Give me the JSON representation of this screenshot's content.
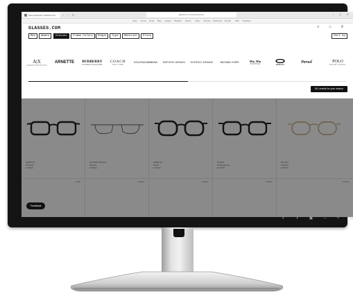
{
  "browser": {
    "tab_title": "Shop Eyewear | Glasses.com",
    "nav_buttons": "‹ › ⟳",
    "url": "glasses.com/shop/eyewear",
    "window_buttons": "– ▢ ✕",
    "bookmarks": [
      "Apps",
      "Home",
      "News",
      "Blog",
      "Images",
      "Weather",
      "Sports",
      "Video",
      "Finance",
      "Facebook",
      "Tutorial",
      "Mail",
      "Translate"
    ]
  },
  "site": {
    "logo": "GLASSES.COM",
    "header_icons": "⌕ ⌂ ≡",
    "filters": [
      {
        "label": "Men",
        "active": false
      },
      {
        "label": "Women",
        "active": false
      },
      {
        "label": "Glasses",
        "active": true
      },
      {
        "label": "Frame Colors",
        "active": false
      },
      {
        "label": "Shape",
        "active": false
      },
      {
        "label": "Type",
        "active": false
      },
      {
        "label": "Material",
        "active": false
      },
      {
        "label": "Price",
        "active": false
      }
    ],
    "sort_label": "Sort by"
  },
  "brands": [
    {
      "name": "A|X",
      "sub": "ARMANI EXCHANGE"
    },
    {
      "name": "ARNETTE",
      "sub": ""
    },
    {
      "name": "BURBERRY",
      "sub": "LONDON ENGLAND"
    },
    {
      "name": "COACH",
      "sub": "NEW YORK"
    },
    {
      "name": "DOLCE&GABBANA",
      "sub": ""
    },
    {
      "name": "EMPORIO ARMANI",
      "sub": ""
    },
    {
      "name": "GIORGIO ARMANI",
      "sub": ""
    },
    {
      "name": "MICHAEL KORS",
      "sub": ""
    },
    {
      "name": "Miu Miu",
      "sub": "EYEWEAR"
    },
    {
      "name": "OAKLEY",
      "sub": ""
    },
    {
      "name": "Persol",
      "sub": ""
    },
    {
      "name": "POLO",
      "sub": "RALPH LAUREN"
    }
  ],
  "results_label": "611 results for your search",
  "products": [
    {
      "brand": "ARNETTE",
      "model": "Standard",
      "price": "$ 105.00"
    },
    {
      "brand": "RAY-BAN OPTICAL",
      "model": "Rimless",
      "price": "$ 150.00"
    },
    {
      "brand": "ARNETTE",
      "model": "Round",
      "price": "$ 180.00"
    },
    {
      "brand": "COACH",
      "model": "Rectangle Line",
      "price": "$ 176.00"
    },
    {
      "brand": "MIU MIU",
      "model": "Oval Mix",
      "price": "$ 365.00"
    }
  ],
  "second_row_tags": [
    "1 color",
    "2 colors",
    "2 colors",
    "3 colors",
    "2 colors"
  ],
  "feedback_label": "Feedback",
  "monitor_controls": "◐ ◑ ▣ – + ⏻",
  "colors": {
    "overlay": "#8a8a8a",
    "accent": "#111111",
    "bezel": "#141414"
  }
}
